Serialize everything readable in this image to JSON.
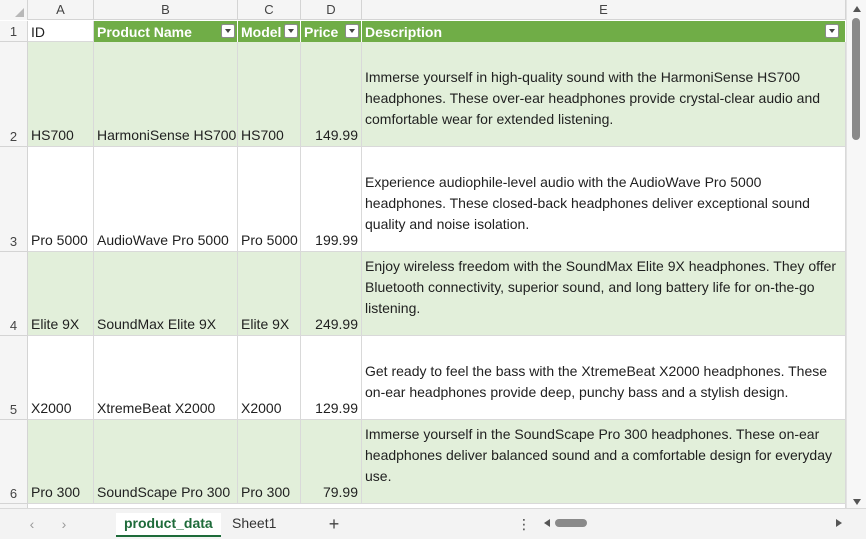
{
  "columns": [
    "A",
    "B",
    "C",
    "D",
    "E"
  ],
  "header_row": {
    "row_number": "1",
    "id": "ID",
    "product_name": "Product Name",
    "model": "Model",
    "price": "Price",
    "description": "Description"
  },
  "rows": [
    {
      "row_number": "2",
      "id": "HS700",
      "product_name": "HarmoniSense HS700",
      "model": "HS700",
      "price": "149.99",
      "description": "Immerse yourself in high-quality sound with the HarmoniSense HS700 headphones. These over-ear headphones provide crystal-clear audio and comfortable wear for extended listening."
    },
    {
      "row_number": "3",
      "id": "Pro 5000",
      "product_name": "AudioWave Pro 5000",
      "model": "Pro 5000",
      "price": "199.99",
      "description": "Experience audiophile-level audio with the AudioWave Pro 5000 headphones. These closed-back headphones deliver exceptional sound quality and noise isolation."
    },
    {
      "row_number": "4",
      "id": "Elite 9X",
      "product_name": "SoundMax Elite 9X",
      "model": "Elite 9X",
      "price": "249.99",
      "description": "Enjoy wireless freedom with the SoundMax Elite 9X headphones. They offer Bluetooth connectivity, superior sound, and long battery life for on-the-go listening."
    },
    {
      "row_number": "5",
      "id": "X2000",
      "product_name": "XtremeBeat X2000",
      "model": "X2000",
      "price": "129.99",
      "description": "Get ready to feel the bass with the XtremeBeat X2000 headphones. These on-ear headphones provide deep, punchy bass and a stylish design."
    },
    {
      "row_number": "6",
      "id": "Pro 300",
      "product_name": "SoundScape Pro 300",
      "model": "Pro 300",
      "price": "79.99",
      "description": "Immerse yourself in the SoundScape Pro 300 headphones. These on-ear headphones deliver balanced sound and a comfortable design for everyday use."
    }
  ],
  "sheet_tabs": [
    {
      "label": "product_data",
      "active": true
    },
    {
      "label": "Sheet1",
      "active": false
    }
  ],
  "colors": {
    "table_header": "#70ad47",
    "band_green": "#e2efda",
    "active_tab": "#1e6b3a"
  },
  "icons": {
    "filter": "chevron-down-icon",
    "add_sheet": "plus-icon",
    "more": "vertical-ellipsis-icon"
  }
}
